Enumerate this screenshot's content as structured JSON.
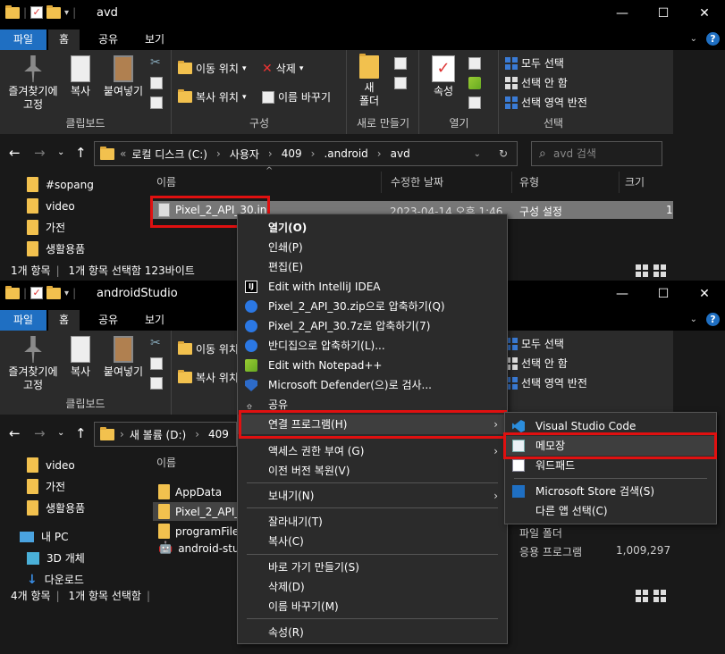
{
  "win1": {
    "title": "avd",
    "tabs": [
      "파일",
      "홈",
      "공유",
      "보기"
    ],
    "ribbon": {
      "clipboard": {
        "pin": "즐겨찾기에\n고정",
        "copy": "복사",
        "paste": "붙여넣기",
        "label": "클립보드"
      },
      "organize": {
        "move": "이동 위치",
        "delete": "삭제",
        "copy_to": "복사 위치",
        "rename": "이름 바꾸기",
        "label": "구성"
      },
      "new": {
        "new_folder": "새\n폴더",
        "label": "새로 만들기"
      },
      "open": {
        "props": "속성",
        "label": "열기"
      },
      "select": {
        "all": "모두 선택",
        "none": "선택 안 함",
        "invert": "선택 영역 반전",
        "label": "선택"
      }
    },
    "breadcrumb": [
      "로컬 디스크 (C:)",
      "사용자",
      "409",
      ".android",
      "avd"
    ],
    "search_placeholder": "avd 검색",
    "nav": [
      "#sopang",
      "video",
      "가전",
      "생활용품"
    ],
    "columns": [
      "이름",
      "수정한 날짜",
      "유형",
      "크기"
    ],
    "file": {
      "name": "Pixel_2_API_30.ini",
      "date": "2023-04-14 오후 1:46",
      "type": "구성 설정",
      "size": "1"
    },
    "status": {
      "count": "1개 항목",
      "selected": "1개 항목 선택함 123바이트"
    }
  },
  "win2": {
    "title": "androidStudio",
    "tabs": [
      "파일",
      "홈",
      "공유",
      "보기"
    ],
    "ribbon": {
      "clipboard": {
        "pin": "즐겨찾기에\n고정",
        "copy": "복사",
        "paste": "붙여넣기",
        "label": "클립보드"
      },
      "organize": {
        "move": "이동 위치",
        "copy_to": "복사 위치"
      },
      "select": {
        "all": "모두 선택",
        "none": "선택 안 함",
        "invert": "선택 영역 반전"
      }
    },
    "breadcrumb": [
      "새 볼륨 (D:)",
      "409"
    ],
    "nav": [
      "video",
      "가전",
      "생활용품",
      "내 PC",
      "3D 개체",
      "다운로드"
    ],
    "columns": [
      "이름"
    ],
    "files": [
      "AppData",
      "Pixel_2_API_3",
      "programFiles",
      "android-stud"
    ],
    "right_values": {
      "r1": "파일 폴더",
      "r2_type": "응용 프로그램",
      "r2_size": "1,009,297"
    },
    "status": {
      "count": "4개 항목",
      "selected": "1개 항목 선택함"
    }
  },
  "context_menu": {
    "items": [
      "열기(O)",
      "인쇄(P)",
      "편집(E)",
      "Edit with IntelliJ IDEA",
      "Pixel_2_API_30.zip으로 압축하기(Q)",
      "Pixel_2_API_30.7z로 압축하기(7)",
      "반디집으로 압축하기(L)...",
      "Edit with Notepad++",
      "Microsoft Defender(으)로 검사...",
      "공유",
      "연결 프로그램(H)",
      "액세스 권한 부여 (G)",
      "이전 버전 복원(V)",
      "보내기(N)",
      "잘라내기(T)",
      "복사(C)",
      "바로 가기 만들기(S)",
      "삭제(D)",
      "이름 바꾸기(M)",
      "속성(R)"
    ]
  },
  "submenu": {
    "items": [
      "Visual Studio Code",
      "메모장",
      "워드패드",
      "Microsoft Store 검색(S)",
      "다른 앱 선택(C)"
    ]
  }
}
